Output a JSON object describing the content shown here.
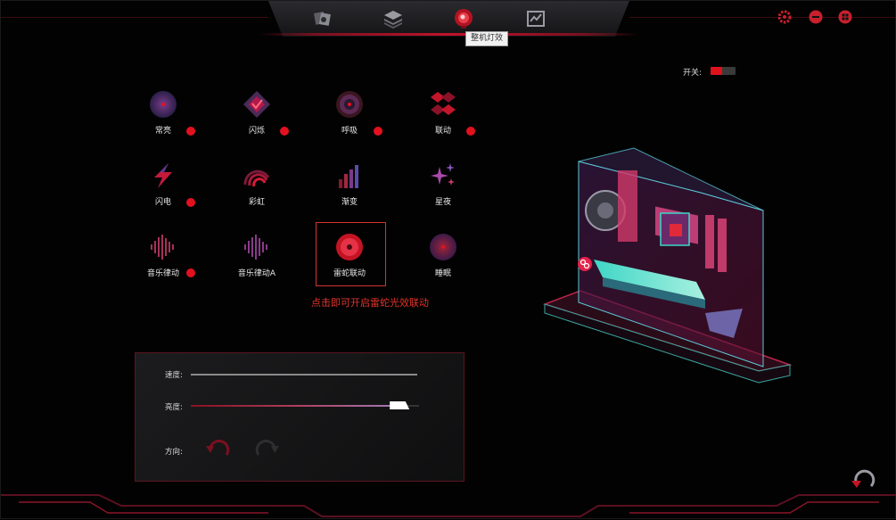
{
  "tooltip": "整机灯效",
  "switch": {
    "label": "开关:",
    "on": true
  },
  "effects": [
    {
      "label": "常亮",
      "icon": "disc-icon",
      "dot": true
    },
    {
      "label": "闪烁",
      "icon": "diamond-flash-icon",
      "dot": true
    },
    {
      "label": "呼吸",
      "icon": "breath-icon",
      "dot": true
    },
    {
      "label": "联动",
      "icon": "link-cubes-icon",
      "dot": true
    },
    {
      "label": "闪电",
      "icon": "lightning-icon",
      "dot": true
    },
    {
      "label": "彩虹",
      "icon": "rainbow-icon",
      "dot": false
    },
    {
      "label": "渐变",
      "icon": "gradient-bars-icon",
      "dot": false
    },
    {
      "label": "星夜",
      "icon": "stars-icon",
      "dot": false
    },
    {
      "label": "音乐律动",
      "icon": "music-wave-icon",
      "dot": true
    },
    {
      "label": "音乐律动A",
      "icon": "music-wave-a-icon",
      "dot": false
    },
    {
      "label": "雷蛇联动",
      "icon": "razer-sync-icon",
      "dot": false,
      "selected": true
    },
    {
      "label": "睡眠",
      "icon": "sleep-icon",
      "dot": false
    }
  ],
  "hint": "点击即可开启雷蛇光效联动",
  "panel": {
    "speed_label": "速度:",
    "brightness_label": "亮度:",
    "direction_label": "方向:",
    "brightness_value": 0.95
  },
  "colors": {
    "accent": "#e2111f",
    "hint": "#e2342a",
    "panel_border": "#5a1520"
  }
}
